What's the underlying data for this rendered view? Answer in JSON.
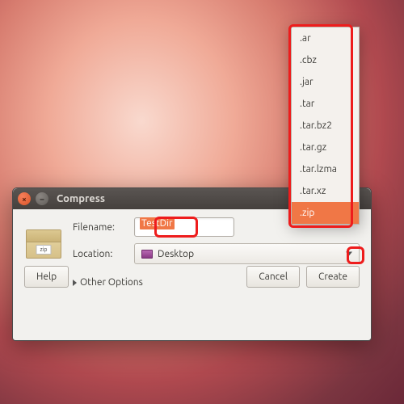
{
  "window": {
    "title": "Compress",
    "close_glyph": "×",
    "min_glyph": "–"
  },
  "form": {
    "filename_label": "Filename:",
    "filename_value": "TestDir",
    "location_label": "Location:",
    "location_value": "Desktop",
    "other_options": "Other Options"
  },
  "buttons": {
    "help": "Help",
    "cancel": "Cancel",
    "create": "Create"
  },
  "icon": {
    "zip_label": "zip"
  },
  "dropdown": {
    "items": [
      ".ar",
      ".cbz",
      ".jar",
      ".tar",
      ".tar.bz2",
      ".tar.gz",
      ".tar.lzma",
      ".tar.xz",
      ".zip"
    ],
    "selected": ".zip"
  }
}
